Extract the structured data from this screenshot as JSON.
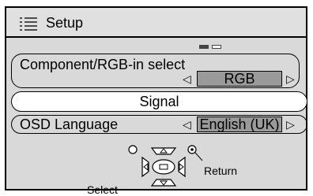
{
  "header": {
    "title": "Setup",
    "icon": "list-icon"
  },
  "page_indicator": {
    "pages": 2,
    "current": 1
  },
  "menu": {
    "component_rgb": {
      "label": "Component/RGB-in select",
      "value": "RGB"
    },
    "signal": {
      "label": "Signal"
    },
    "osd_language": {
      "label": "OSD  Language",
      "value": "English (UK)"
    }
  },
  "nav_help": {
    "select_label": "Select",
    "return_label": "Return"
  }
}
